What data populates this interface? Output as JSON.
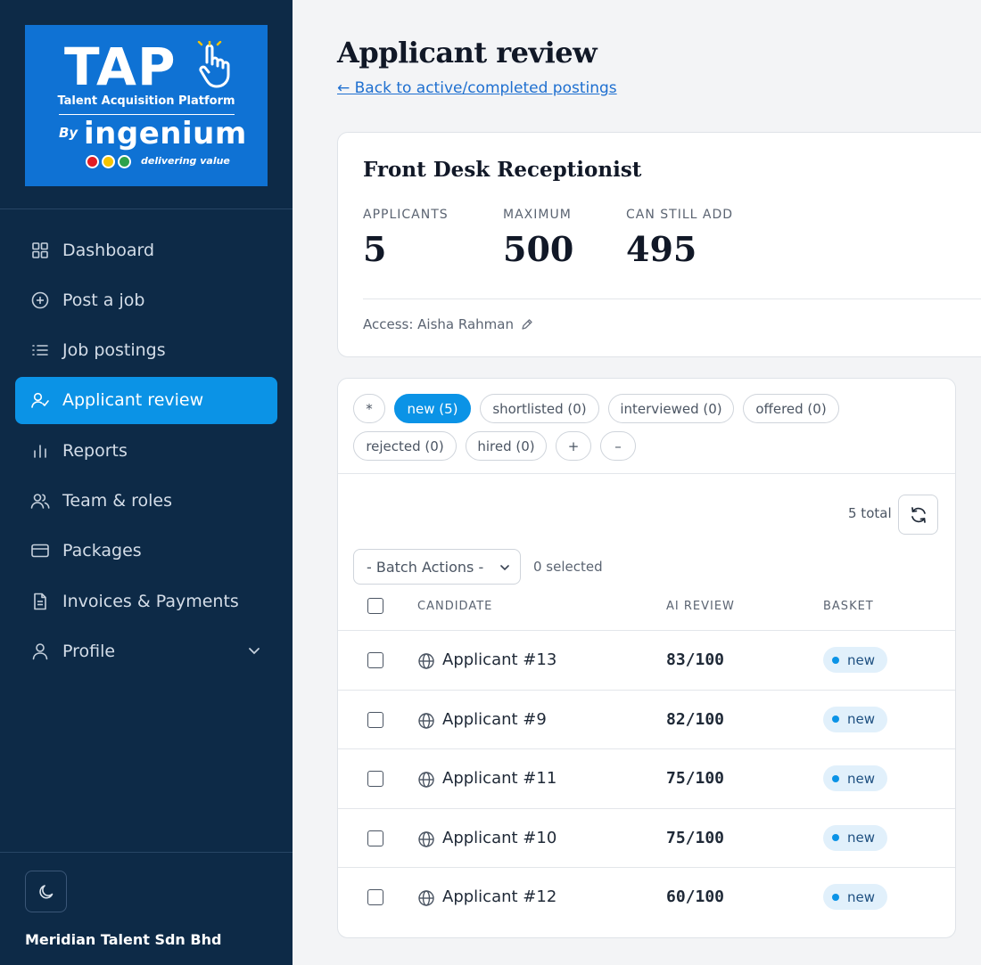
{
  "logo": {
    "title": "TAP",
    "subtitle": "Talent Acquisition Platform",
    "by": "By",
    "brand": "ingenium",
    "tagline": "delivering value",
    "dot_colors": [
      "#e11d25",
      "#f5c400",
      "#2ea24a"
    ]
  },
  "sidebar": {
    "items": [
      {
        "label": "Dashboard",
        "icon": "grid-icon"
      },
      {
        "label": "Post a job",
        "icon": "plus-circle-icon"
      },
      {
        "label": "Job postings",
        "icon": "list-icon"
      },
      {
        "label": "Applicant review",
        "icon": "user-check-icon",
        "active": true
      },
      {
        "label": "Reports",
        "icon": "bar-chart-icon"
      },
      {
        "label": "Team & roles",
        "icon": "users-icon"
      },
      {
        "label": "Packages",
        "icon": "card-icon"
      },
      {
        "label": "Invoices & Payments",
        "icon": "document-icon"
      },
      {
        "label": "Profile",
        "icon": "user-icon"
      }
    ],
    "theme_toggle_icon": "moon-icon",
    "company": "Meridian Talent Sdn Bhd"
  },
  "header": {
    "title": "Applicant review",
    "back_link": "← Back to active/completed postings"
  },
  "job": {
    "title": "Front Desk Receptionist",
    "stats": [
      {
        "label": "APPLICANTS",
        "value": "5"
      },
      {
        "label": "MAXIMUM",
        "value": "500"
      },
      {
        "label": "CAN STILL ADD",
        "value": "495"
      }
    ],
    "access": "Access: Aisha Rahman",
    "access_icon": "pencil-icon"
  },
  "filters": {
    "chips": [
      "*",
      "new (5)",
      "shortlisted (0)",
      "interviewed (0)",
      "offered (0)",
      "rejected (0)",
      "hired (0)",
      "+",
      "–"
    ],
    "active_index": 1
  },
  "toolbar": {
    "total": "5 total",
    "refresh_icon": "refresh-icon",
    "batch_label": "- Batch Actions -",
    "selected": "0 selected"
  },
  "table": {
    "columns": [
      "CANDIDATE",
      "AI REVIEW",
      "BASKET"
    ],
    "rows": [
      {
        "name": "Applicant #13",
        "score": "83/100",
        "basket": "new"
      },
      {
        "name": "Applicant #9",
        "score": "82/100",
        "basket": "new"
      },
      {
        "name": "Applicant #11",
        "score": "75/100",
        "basket": "new"
      },
      {
        "name": "Applicant #10",
        "score": "75/100",
        "basket": "new"
      },
      {
        "name": "Applicant #12",
        "score": "60/100",
        "basket": "new"
      }
    ]
  },
  "colors": {
    "sidebar_bg": "#0d2a47",
    "accent": "#0b93e6",
    "logo_bg": "#0f72d4"
  }
}
